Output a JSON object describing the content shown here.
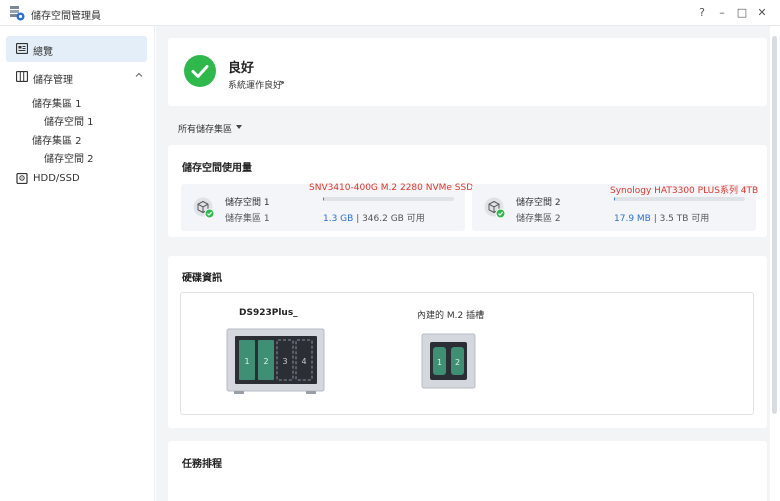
{
  "window": {
    "title": "儲存空間管理員",
    "controls": [
      "?",
      "–",
      "□",
      "✕"
    ]
  },
  "sidebar": {
    "items": [
      {
        "label": "總覽",
        "active": true,
        "icon": "overview-icon"
      },
      {
        "label": "儲存管理",
        "active": false,
        "icon": "storage-manage-icon",
        "expanded": true,
        "children": [
          {
            "label": "儲存集區 1",
            "children": [
              {
                "label": "儲存空間 1"
              }
            ]
          },
          {
            "label": "儲存集區 2",
            "children": [
              {
                "label": "儲存空間 2"
              }
            ]
          }
        ]
      },
      {
        "label": "HDD/SSD",
        "active": false,
        "icon": "disk-icon"
      }
    ]
  },
  "status": {
    "title": "良好",
    "subtitle": "系統運作良好",
    "color": "#2fb94d"
  },
  "filter": {
    "label": "所有儲存集區"
  },
  "usage": {
    "title": "儲存空間使用量",
    "volumes": [
      {
        "name": "儲存空間 1",
        "pool": "儲存集區 1",
        "note": "SNV3410-400G M.2 2280 NVMe SSD",
        "used": "1.3 GB",
        "rest": " | 346.2 GB 可用",
        "used_fraction": 0.004
      },
      {
        "name": "儲存空間 2",
        "pool": "儲存集區 2",
        "note": "Synology HAT3300 PLUS系列 4TB",
        "used": "17.9 MB",
        "rest": " | 3.5 TB 可用",
        "used_fraction": 0.001
      }
    ]
  },
  "hardware": {
    "title": "硬碟資訊",
    "device_name": "DS923Plus_",
    "bays": [
      "1",
      "2",
      "3",
      "4"
    ],
    "m2_label": "內建的 M.2 插槽",
    "m2_slots": [
      "1",
      "2"
    ]
  },
  "tasks": {
    "title": "任務排程"
  },
  "colors": {
    "accent": "#3577d4",
    "success": "#2fb94d",
    "note": "#e0362c",
    "drive_green": "#3f8f75"
  }
}
